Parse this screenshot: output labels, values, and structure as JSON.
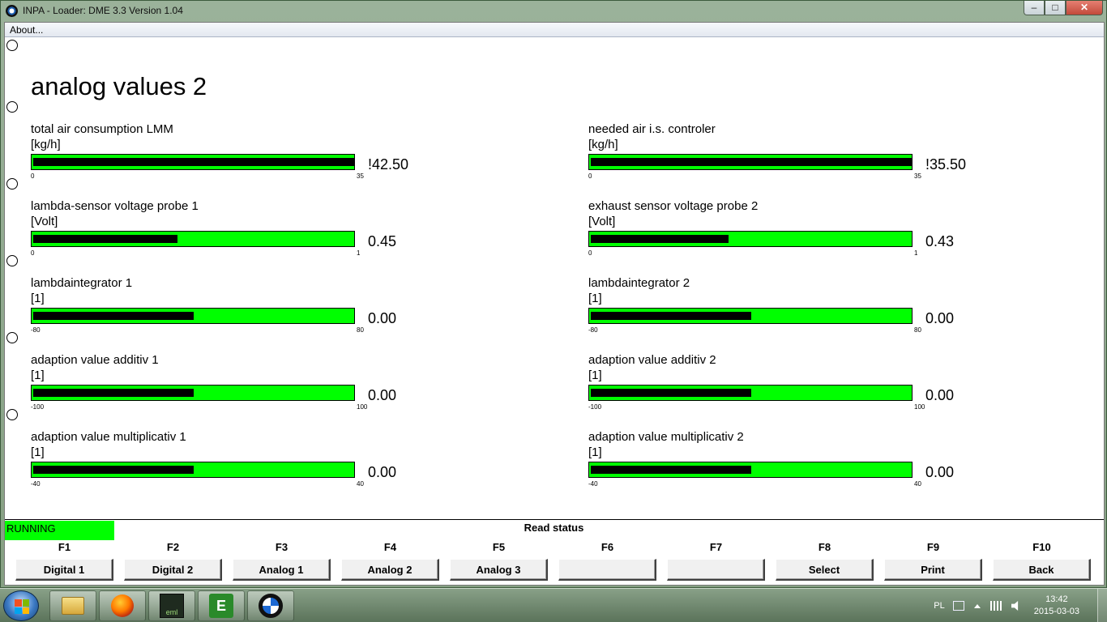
{
  "window": {
    "title": "INPA - Loader:  DME 3.3 Version 1.04",
    "min_label": "–",
    "max_label": "□",
    "close_label": "✕"
  },
  "menu": {
    "about": "About..."
  },
  "page": {
    "title": "analog values 2"
  },
  "gauges": [
    {
      "label": "total air consumption LMM",
      "unit": "[kg/h]",
      "min": "0",
      "max": "35",
      "value": "!42.50",
      "fill": 1.0
    },
    {
      "label": "needed air i.s. controler",
      "unit": "[kg/h]",
      "min": "0",
      "max": "35",
      "value": "!35.50",
      "fill": 1.0
    },
    {
      "label": "lambda-sensor voltage probe 1",
      "unit": "[Volt]",
      "min": "0",
      "max": "1",
      "value": "0.45",
      "fill": 0.45
    },
    {
      "label": "exhaust sensor voltage probe 2",
      "unit": "[Volt]",
      "min": "0",
      "max": "1",
      "value": "0.43",
      "fill": 0.43
    },
    {
      "label": "lambdaintegrator 1",
      "unit": "[1]",
      "min": "-80",
      "max": "80",
      "value": "0.00",
      "fill": 0.5
    },
    {
      "label": "lambdaintegrator 2",
      "unit": "[1]",
      "min": "-80",
      "max": "80",
      "value": "0.00",
      "fill": 0.5
    },
    {
      "label": "adaption value additiv 1",
      "unit": "[1]",
      "min": "-100",
      "max": "100",
      "value": "0.00",
      "fill": 0.5
    },
    {
      "label": "adaption value additiv 2",
      "unit": "[1]",
      "min": "-100",
      "max": "100",
      "value": "0.00",
      "fill": 0.5
    },
    {
      "label": "adaption value multiplicativ 1",
      "unit": "[1]",
      "min": "-40",
      "max": "40",
      "value": "0.00",
      "fill": 0.5
    },
    {
      "label": "adaption value multiplicativ 2",
      "unit": "[1]",
      "min": "-40",
      "max": "40",
      "value": "0.00",
      "fill": 0.5
    }
  ],
  "status": {
    "running": "RUNNING",
    "text": "Read status"
  },
  "fkeys": [
    {
      "key": "F1",
      "label": "Digital 1"
    },
    {
      "key": "F2",
      "label": "Digital 2"
    },
    {
      "key": "F3",
      "label": "Analog 1"
    },
    {
      "key": "F4",
      "label": "Analog 2"
    },
    {
      "key": "F5",
      "label": "Analog 3"
    },
    {
      "key": "F6",
      "label": ""
    },
    {
      "key": "F7",
      "label": ""
    },
    {
      "key": "F8",
      "label": "Select"
    },
    {
      "key": "F9",
      "label": "Print"
    },
    {
      "key": "F10",
      "label": "Back"
    }
  ],
  "taskbar": {
    "apps": [
      "folder-icon",
      "firefox-icon",
      "eml-icon",
      "e-icon",
      "bmw-icon"
    ],
    "eml_text": "eml",
    "e_text": "E",
    "language": "PL",
    "time": "13:42",
    "date": "2015-03-03"
  },
  "colors": {
    "bar_green": "#00ff00",
    "bar_fill": "#000000",
    "running_green": "#00ff00"
  }
}
